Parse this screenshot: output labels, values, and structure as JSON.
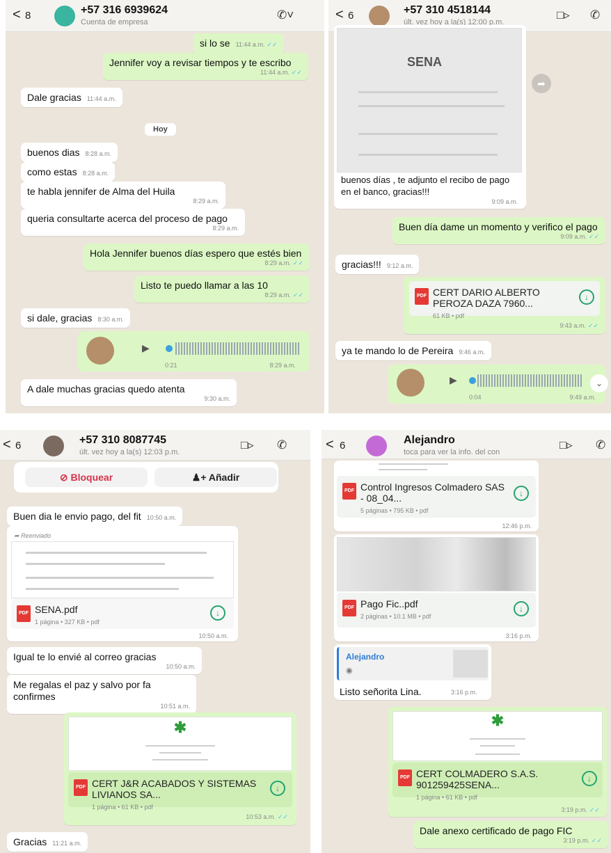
{
  "p1": {
    "back": "<",
    "count": "8",
    "name": "+57 316 6939624",
    "sub": "Cuenta de empresa",
    "msgs": [
      {
        "text": "si lo se",
        "time": "11:44 a.m."
      },
      {
        "text": "Jennifer voy a revisar tiempos y te escribo",
        "time": "11:44 a.m."
      },
      {
        "text": "Dale gracias",
        "time": "11:44 a.m."
      },
      {
        "text": "buenos dias",
        "time": "8:28 a.m."
      },
      {
        "text": "como estas",
        "time": "8:28 a.m."
      },
      {
        "text": "te habla jennifer de Alma del Huila",
        "time": "8:29 a.m."
      },
      {
        "text": "queria consultarte acerca del proceso de pago",
        "time": "8:29 a.m."
      },
      {
        "text": "Hola Jennifer buenos días espero que estés bien",
        "time": "8:29 a.m."
      },
      {
        "text": "Listo te puedo llamar a las 10",
        "time": "8:29 a.m."
      },
      {
        "text": "si dale, gracias",
        "time": "8:30 a.m."
      },
      {
        "text": "A dale muchas gracias quedo atenta",
        "time": "9:30 a.m."
      }
    ],
    "day": "Hoy",
    "voice": {
      "duration": "0:21",
      "time": "8:29 a.m."
    }
  },
  "p2": {
    "back": "<",
    "count": "6",
    "name": "+57 310 4518144",
    "sub": "últ. vez hoy a la(s) 12:00 p.m.",
    "img_caption": "buenos días , te adjunto el recibo de pago en el banco, gracias!!!",
    "img_time": "9:09 a.m.",
    "sena": "SENA",
    "msgs": [
      {
        "text": "Buen día dame un momento y verifico el pago",
        "time": "9:09 a.m."
      },
      {
        "text": "gracias!!!",
        "time": "9:12 a.m."
      },
      {
        "text": "ya te mando lo de Pereira",
        "time": "9:46 a.m."
      }
    ],
    "doc": {
      "name": "CERT DARIO ALBERTO PEROZA DAZA 7960...",
      "meta": "61 KB • pdf",
      "time": "9:43 a.m."
    },
    "voice": {
      "duration": "0:04",
      "time": "9:49 a.m."
    }
  },
  "p3": {
    "back": "<",
    "count": "6",
    "name": "+57 310 8087745",
    "sub": "últ. vez hoy a la(s) 12:03 p.m.",
    "block": "Bloquear",
    "add": "Añadir",
    "msgs": [
      {
        "text": "Buen dia le envio pago,  del fit",
        "time": "10:50 a.m."
      },
      {
        "text": "Igual te lo envié al correo gracias",
        "time": "10:50 a.m."
      },
      {
        "text": "Me regalas el paz y salvo por fa confirmes",
        "time": "10:51 a.m."
      },
      {
        "text": "Gracias",
        "time": "11:21 a.m."
      }
    ],
    "forwarded": "Reenviado",
    "doc1": {
      "name": "SENA.pdf",
      "meta": "1 página • 327 KB • pdf",
      "time": "10:50 a.m."
    },
    "doc2": {
      "name": "CERT J&R ACABADOS Y SISTEMAS LIVIANOS SA...",
      "meta": "1 página • 61 KB • pdf",
      "time": "10:53 a.m."
    }
  },
  "p4": {
    "back": "<",
    "count": "6",
    "name": "Alejandro",
    "sub": "toca para ver la info. del con",
    "doc1": {
      "name": "Control Ingresos Colmadero SAS - 08_04...",
      "meta": "5 páginas • 795 KB • pdf",
      "time": "12:46 p.m."
    },
    "doc2": {
      "name": "Pago Fic..pdf",
      "meta": "2 páginas • 10.1 MB • pdf",
      "time": "3:16 p.m."
    },
    "reply": {
      "author": "Alejandro",
      "text": "Listo señorita Lina.",
      "time": "3:16 p.m."
    },
    "doc3": {
      "name": "CERT COLMADERO S.A.S. 901259425SENA...",
      "meta": "1 página • 61 KB • pdf",
      "time": "3:19 p.m."
    },
    "last": {
      "text": "Dale anexo certificado de pago FIC",
      "time": "3:19 p.m."
    }
  },
  "pdf_label": "PDF",
  "colors": {
    "outgoing": "#dcf7c5",
    "incoming": "#ffffff",
    "bg": "#ece5dc",
    "tick": "#53bdeb",
    "pdf": "#e53935"
  }
}
